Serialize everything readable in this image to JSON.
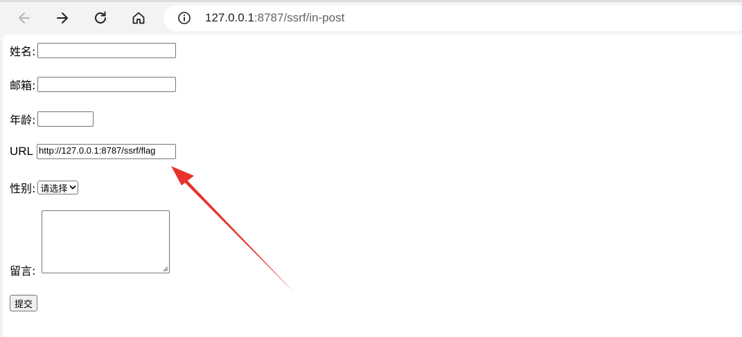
{
  "browser": {
    "url_host": "127.0.0.1",
    "url_path": ":8787/ssrf/in-post",
    "icons": [
      "back-icon",
      "forward-icon",
      "reload-icon",
      "home-icon",
      "info-icon"
    ]
  },
  "form": {
    "name_label": "姓名:",
    "name_value": "",
    "email_label": "邮箱:",
    "email_value": "",
    "age_label": "年龄:",
    "age_value": "",
    "url_label": "URL",
    "url_value": "http://127.0.0.1:8787/ssrf/flag",
    "gender_label": "性别:",
    "gender_selected": "请选择",
    "message_label": "留言:",
    "message_value": "",
    "submit_label": "提交"
  },
  "annotation": {
    "arrow_color": "#e8322b"
  }
}
